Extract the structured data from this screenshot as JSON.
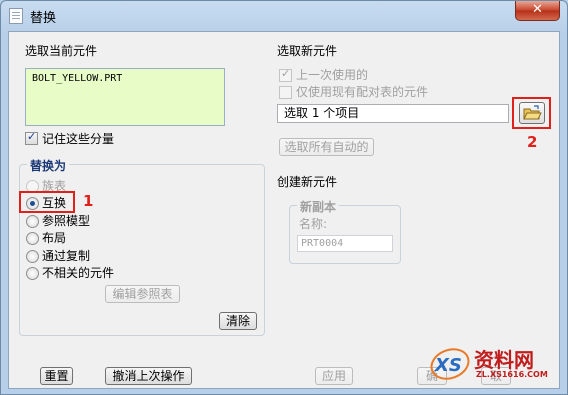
{
  "window": {
    "title": "替换",
    "close_glyph": "✕"
  },
  "left": {
    "section_label": "选取当前元件",
    "components": [
      "BOLT_YELLOW.PRT"
    ],
    "remember_label": "记住这些分量",
    "remember_checked": true,
    "replace_group": {
      "title": "替换为",
      "options": [
        {
          "label": "族表",
          "checked": false,
          "enabled": false
        },
        {
          "label": "互换",
          "checked": true,
          "enabled": true
        },
        {
          "label": "参照模型",
          "checked": false,
          "enabled": true
        },
        {
          "label": "布局",
          "checked": false,
          "enabled": true
        },
        {
          "label": "通过复制",
          "checked": false,
          "enabled": true
        },
        {
          "label": "不相关的元件",
          "checked": false,
          "enabled": true
        }
      ],
      "edit_ref_table_label": "编辑参照表"
    },
    "clear_label": "清除"
  },
  "right": {
    "section_label": "选取新元件",
    "last_used_label": "上一次使用的",
    "last_used_checked": true,
    "only_pair_table_label": "仅使用现有配对表的元件",
    "only_pair_table_checked": false,
    "selection_value": "选取 1 个项目",
    "select_all_auto_label": "选取所有自动的",
    "create_new_label": "创建新元件",
    "new_copy_group": {
      "title": "新副本",
      "name_label": "名称:",
      "name_placeholder": "PRT0004"
    }
  },
  "annotations": {
    "marker_1": "1",
    "marker_2": "2"
  },
  "footer": {
    "reset_label": "重置",
    "undo_label": "撤消上次操作",
    "apply_label": "应用",
    "ok_label": "确",
    "cancel_label": "取"
  },
  "watermark": {
    "text": "资料网",
    "url": "ZL.XS1616.COM",
    "logo": "XS"
  },
  "colors": {
    "accent_red": "#e0201b",
    "list_bg": "#e8fcc8",
    "group_title": "#1d3a78"
  }
}
